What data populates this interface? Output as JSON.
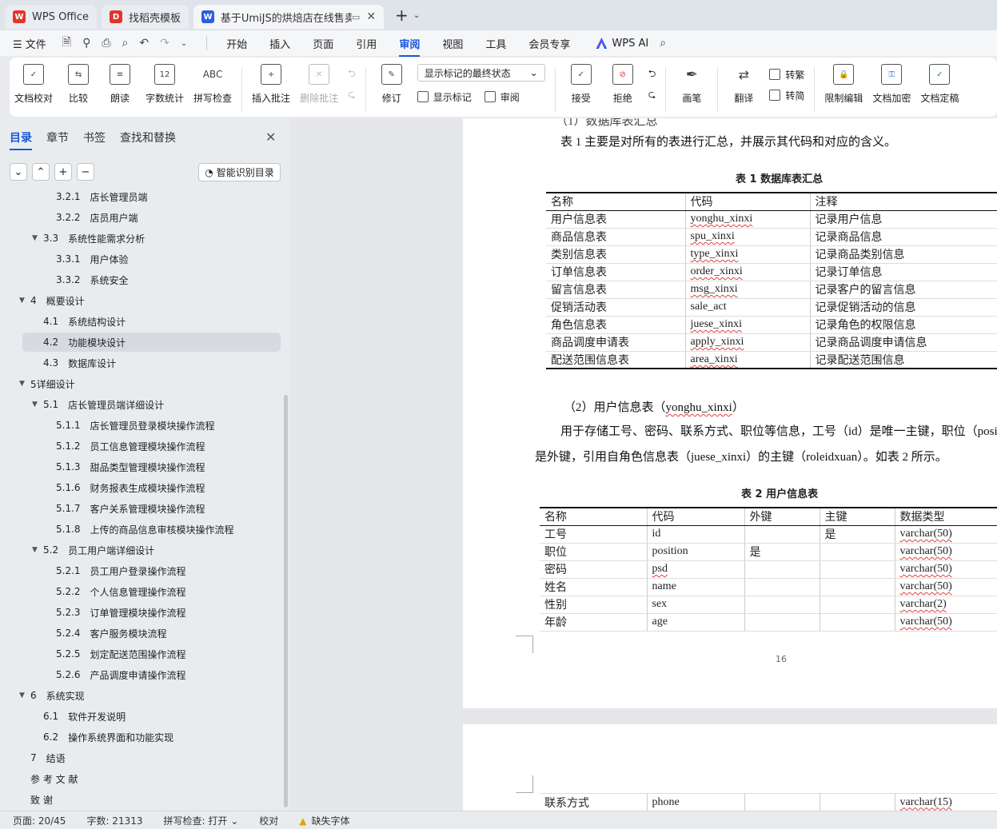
{
  "tabs": [
    {
      "label": "WPS Office",
      "logo": "W",
      "color": "#e0352b"
    },
    {
      "label": "找稻壳模板",
      "logo": "D",
      "color": "#e0352b"
    },
    {
      "label": "基于UmiJS的烘焙店在线售卖",
      "logo": "W",
      "color": "#2b5ce6"
    }
  ],
  "menubar": {
    "file": "文件",
    "items": [
      "开始",
      "插入",
      "页面",
      "引用",
      "审阅",
      "视图",
      "工具",
      "会员专享"
    ],
    "active": "审阅",
    "ai": "WPS AI"
  },
  "ribbon": {
    "proofread": "文档校对",
    "compare": "比较",
    "read_aloud": "朗读",
    "word_count": "字数统计",
    "spell_check": "拼写检查",
    "abc": "ABC",
    "twelve": "12",
    "insert_comment": "插入批注",
    "delete_comment": "删除批注",
    "revise": "修订",
    "markup_dropdown": "显示标记的最终状态",
    "show_markup": "显示标记",
    "review": "审阅",
    "accept": "接受",
    "reject": "拒绝",
    "pen": "画笔",
    "translate": "翻译",
    "to_traditional": "转繁",
    "to_simplified": "转简",
    "restrict_edit": "限制编辑",
    "encrypt": "文档加密",
    "finalize": "文档定稿"
  },
  "sidebar": {
    "tabs": [
      "目录",
      "章节",
      "书签",
      "查找和替换"
    ],
    "smart_btn": "智能识别目录",
    "toc": [
      {
        "num": "3.2.1",
        "text": "店长管理员端",
        "level": 3
      },
      {
        "num": "3.2.2",
        "text": "店员用户端",
        "level": 3
      },
      {
        "num": "3.3",
        "text": "系统性能需求分析",
        "level": 2,
        "caret": true
      },
      {
        "num": "3.3.1",
        "text": "用户体验",
        "level": 3
      },
      {
        "num": "3.3.2",
        "text": "系统安全",
        "level": 3
      },
      {
        "num": "4",
        "text": "概要设计",
        "level": 1,
        "caret": true
      },
      {
        "num": "4.1",
        "text": "系统结构设计",
        "level": 2
      },
      {
        "num": "4.2",
        "text": "功能模块设计",
        "level": 2,
        "selected": true
      },
      {
        "num": "4.3",
        "text": "数据库设计",
        "level": 2
      },
      {
        "num": "",
        "text": "5详细设计",
        "level": 1,
        "caret": true
      },
      {
        "num": "5.1",
        "text": "店长管理员端详细设计",
        "level": 2,
        "caret": true
      },
      {
        "num": "5.1.1",
        "text": "店长管理员登录模块操作流程",
        "level": 3
      },
      {
        "num": "5.1.2",
        "text": "员工信息管理模块操作流程",
        "level": 3
      },
      {
        "num": "5.1.3",
        "text": "甜品类型管理模块操作流程",
        "level": 3
      },
      {
        "num": "5.1.6",
        "text": "财务报表生成模块操作流程",
        "level": 3
      },
      {
        "num": "5.1.7",
        "text": "客户关系管理模块操作流程",
        "level": 3
      },
      {
        "num": "5.1.8",
        "text": "上传的商品信息审核模块操作流程",
        "level": 3
      },
      {
        "num": "5.2",
        "text": "员工用户端详细设计",
        "level": 2,
        "caret": true
      },
      {
        "num": "5.2.1",
        "text": "员工用户登录操作流程",
        "level": 3
      },
      {
        "num": "5.2.2",
        "text": "个人信息管理操作流程",
        "level": 3
      },
      {
        "num": "5.2.3",
        "text": "订单管理模块操作流程",
        "level": 3
      },
      {
        "num": "5.2.4",
        "text": "客户服务模块流程",
        "level": 3
      },
      {
        "num": "5.2.5",
        "text": "划定配送范围操作流程",
        "level": 3
      },
      {
        "num": "5.2.6",
        "text": "产品调度申请操作流程",
        "level": 3
      },
      {
        "num": "6",
        "text": "系统实现",
        "level": 1,
        "caret": true
      },
      {
        "num": "6.1",
        "text": "软件开发说明",
        "level": 2
      },
      {
        "num": "6.2",
        "text": "操作系统界面和功能实现",
        "level": 2
      },
      {
        "num": "7",
        "text": "结语",
        "level": 1
      },
      {
        "num": "",
        "text": "参 考 文 献",
        "level": 1
      },
      {
        "num": "",
        "text": "致      谢",
        "level": 1
      }
    ]
  },
  "doc": {
    "partial_heading": "（1）数据库表汇总",
    "intro": "表 1 主要是对所有的表进行汇总，并展示其代码和对应的含义。",
    "table1_caption": "表 1 数据库表汇总",
    "table1_headers": [
      "名称",
      "代码",
      "注释"
    ],
    "table1_rows": [
      [
        "用户信息表",
        "yonghu_xinxi",
        "记录用户信息"
      ],
      [
        "商品信息表",
        "spu_xinxi",
        "记录商品信息"
      ],
      [
        "类别信息表",
        "type_xinxi",
        "记录商品类别信息"
      ],
      [
        "订单信息表",
        "order_xinxi",
        "记录订单信息"
      ],
      [
        "留言信息表",
        "msg_xinxi",
        "记录客户的留言信息"
      ],
      [
        "促销活动表",
        "sale_act",
        "记录促销活动的信息"
      ],
      [
        "角色信息表",
        "juese_xinxi",
        "记录角色的权限信息"
      ],
      [
        "商品调度申请表",
        "apply_xinxi",
        "记录商品调度申请信息"
      ],
      [
        "配送范围信息表",
        "area_xinxi",
        "记录配送范围信息"
      ]
    ],
    "section2_title": "（2）用户信息表（yonghu_xinxi）",
    "para2_line1": "用于存储工号、密码、联系方式、职位等信息，工号（id）是唯一主键，职位（posi",
    "para2_line2": "是外键，引用自角色信息表（juese_xinxi）的主键（roleidxuan）。如表 2 所示。",
    "table2_caption": "表 2 用户信息表",
    "table2_headers": [
      "名称",
      "代码",
      "外键",
      "主键",
      "数据类型"
    ],
    "table2_rows": [
      [
        "工号",
        "id",
        "",
        "是",
        "varchar(50)"
      ],
      [
        "职位",
        "position",
        "是",
        "",
        "varchar(50)"
      ],
      [
        "密码",
        "psd",
        "",
        "",
        "varchar(50)"
      ],
      [
        "姓名",
        "name",
        "",
        "",
        "varchar(50)"
      ],
      [
        "性别",
        "sex",
        "",
        "",
        "varchar(2)"
      ],
      [
        "年龄",
        "age",
        "",
        "",
        "varchar(50)"
      ]
    ],
    "page_number": "16",
    "page2_row": [
      "联系方式",
      "phone",
      "",
      "",
      "varchar(15)"
    ]
  },
  "status": {
    "page": "页面: 20/45",
    "words": "字数: 21313",
    "spell": "拼写检查: 打开",
    "proof": "校对",
    "missing_font": "缺失字体"
  }
}
